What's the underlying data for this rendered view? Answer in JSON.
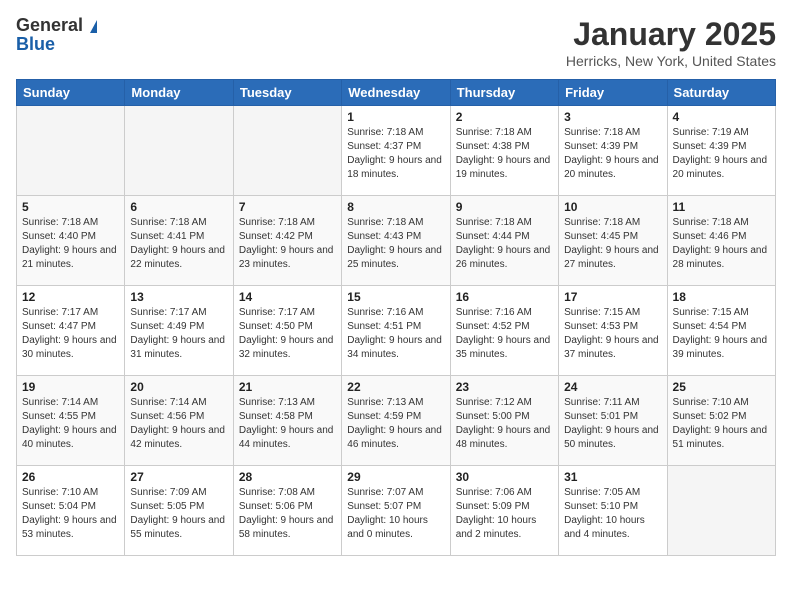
{
  "logo": {
    "general": "General",
    "blue": "Blue"
  },
  "title": "January 2025",
  "location": "Herricks, New York, United States",
  "weekdays": [
    "Sunday",
    "Monday",
    "Tuesday",
    "Wednesday",
    "Thursday",
    "Friday",
    "Saturday"
  ],
  "weeks": [
    [
      {
        "day": "",
        "empty": true
      },
      {
        "day": "",
        "empty": true
      },
      {
        "day": "",
        "empty": true
      },
      {
        "day": "1",
        "sunrise": "7:18 AM",
        "sunset": "4:37 PM",
        "daylight": "9 hours and 18 minutes."
      },
      {
        "day": "2",
        "sunrise": "7:18 AM",
        "sunset": "4:38 PM",
        "daylight": "9 hours and 19 minutes."
      },
      {
        "day": "3",
        "sunrise": "7:18 AM",
        "sunset": "4:39 PM",
        "daylight": "9 hours and 20 minutes."
      },
      {
        "day": "4",
        "sunrise": "7:19 AM",
        "sunset": "4:39 PM",
        "daylight": "9 hours and 20 minutes."
      }
    ],
    [
      {
        "day": "5",
        "sunrise": "7:18 AM",
        "sunset": "4:40 PM",
        "daylight": "9 hours and 21 minutes."
      },
      {
        "day": "6",
        "sunrise": "7:18 AM",
        "sunset": "4:41 PM",
        "daylight": "9 hours and 22 minutes."
      },
      {
        "day": "7",
        "sunrise": "7:18 AM",
        "sunset": "4:42 PM",
        "daylight": "9 hours and 23 minutes."
      },
      {
        "day": "8",
        "sunrise": "7:18 AM",
        "sunset": "4:43 PM",
        "daylight": "9 hours and 25 minutes."
      },
      {
        "day": "9",
        "sunrise": "7:18 AM",
        "sunset": "4:44 PM",
        "daylight": "9 hours and 26 minutes."
      },
      {
        "day": "10",
        "sunrise": "7:18 AM",
        "sunset": "4:45 PM",
        "daylight": "9 hours and 27 minutes."
      },
      {
        "day": "11",
        "sunrise": "7:18 AM",
        "sunset": "4:46 PM",
        "daylight": "9 hours and 28 minutes."
      }
    ],
    [
      {
        "day": "12",
        "sunrise": "7:17 AM",
        "sunset": "4:47 PM",
        "daylight": "9 hours and 30 minutes."
      },
      {
        "day": "13",
        "sunrise": "7:17 AM",
        "sunset": "4:49 PM",
        "daylight": "9 hours and 31 minutes."
      },
      {
        "day": "14",
        "sunrise": "7:17 AM",
        "sunset": "4:50 PM",
        "daylight": "9 hours and 32 minutes."
      },
      {
        "day": "15",
        "sunrise": "7:16 AM",
        "sunset": "4:51 PM",
        "daylight": "9 hours and 34 minutes."
      },
      {
        "day": "16",
        "sunrise": "7:16 AM",
        "sunset": "4:52 PM",
        "daylight": "9 hours and 35 minutes."
      },
      {
        "day": "17",
        "sunrise": "7:15 AM",
        "sunset": "4:53 PM",
        "daylight": "9 hours and 37 minutes."
      },
      {
        "day": "18",
        "sunrise": "7:15 AM",
        "sunset": "4:54 PM",
        "daylight": "9 hours and 39 minutes."
      }
    ],
    [
      {
        "day": "19",
        "sunrise": "7:14 AM",
        "sunset": "4:55 PM",
        "daylight": "9 hours and 40 minutes."
      },
      {
        "day": "20",
        "sunrise": "7:14 AM",
        "sunset": "4:56 PM",
        "daylight": "9 hours and 42 minutes."
      },
      {
        "day": "21",
        "sunrise": "7:13 AM",
        "sunset": "4:58 PM",
        "daylight": "9 hours and 44 minutes."
      },
      {
        "day": "22",
        "sunrise": "7:13 AM",
        "sunset": "4:59 PM",
        "daylight": "9 hours and 46 minutes."
      },
      {
        "day": "23",
        "sunrise": "7:12 AM",
        "sunset": "5:00 PM",
        "daylight": "9 hours and 48 minutes."
      },
      {
        "day": "24",
        "sunrise": "7:11 AM",
        "sunset": "5:01 PM",
        "daylight": "9 hours and 50 minutes."
      },
      {
        "day": "25",
        "sunrise": "7:10 AM",
        "sunset": "5:02 PM",
        "daylight": "9 hours and 51 minutes."
      }
    ],
    [
      {
        "day": "26",
        "sunrise": "7:10 AM",
        "sunset": "5:04 PM",
        "daylight": "9 hours and 53 minutes."
      },
      {
        "day": "27",
        "sunrise": "7:09 AM",
        "sunset": "5:05 PM",
        "daylight": "9 hours and 55 minutes."
      },
      {
        "day": "28",
        "sunrise": "7:08 AM",
        "sunset": "5:06 PM",
        "daylight": "9 hours and 58 minutes."
      },
      {
        "day": "29",
        "sunrise": "7:07 AM",
        "sunset": "5:07 PM",
        "daylight": "10 hours and 0 minutes."
      },
      {
        "day": "30",
        "sunrise": "7:06 AM",
        "sunset": "5:09 PM",
        "daylight": "10 hours and 2 minutes."
      },
      {
        "day": "31",
        "sunrise": "7:05 AM",
        "sunset": "5:10 PM",
        "daylight": "10 hours and 4 minutes."
      },
      {
        "day": "",
        "empty": true
      }
    ]
  ]
}
